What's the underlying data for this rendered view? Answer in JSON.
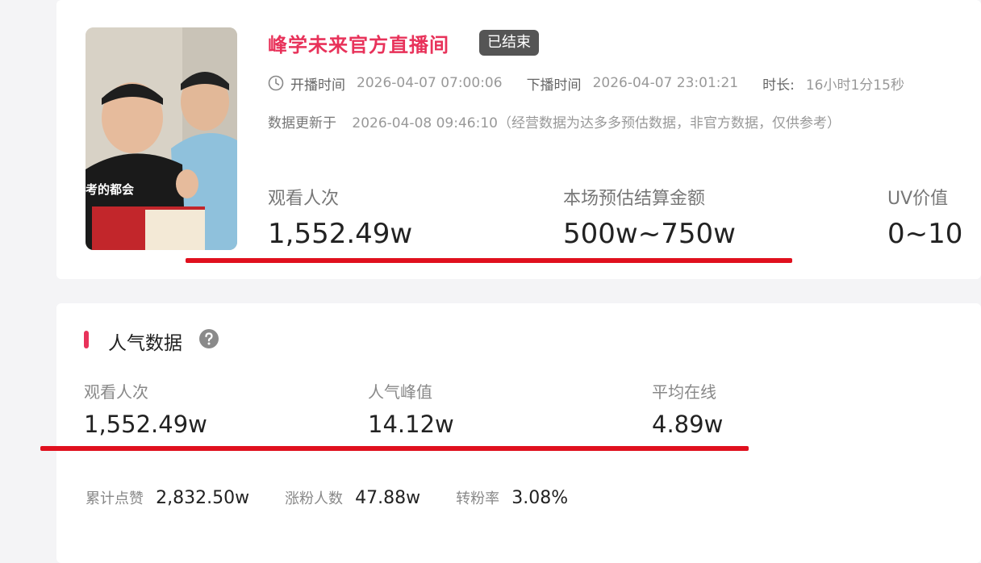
{
  "room": {
    "title": "峰学未来官方直播间",
    "status_badge": "已结束",
    "cover_badge_text": "考的都会",
    "start_label": "开播时间",
    "start_value": "2026-04-07 07:00:06",
    "end_label": "下播时间",
    "end_value": "2026-04-07 23:01:21",
    "duration_label": "时长:",
    "duration_value": "16小时1分15秒",
    "update_label": "数据更新于",
    "update_value": "2026-04-08 09:46:10（经营数据为达多多预估数据，非官方数据，仅供参考）",
    "metrics": {
      "views_label": "观看人次",
      "views_value": "1,552.49w",
      "settle_label": "本场预估结算金额",
      "settle_value": "500w~750w",
      "uv_label": "UV价值",
      "uv_value": "0~10"
    }
  },
  "popularity": {
    "title": "人气数据",
    "views_label": "观看人次",
    "views_value": "1,552.49w",
    "peak_label": "人气峰值",
    "peak_value": "14.12w",
    "avg_label": "平均在线",
    "avg_value": "4.89w",
    "likes_label": "累计点赞",
    "likes_value": "2,832.50w",
    "fans_label": "涨粉人数",
    "fans_value": "47.88w",
    "conv_label": "转粉率",
    "conv_value": "3.08%"
  },
  "icons": {
    "clock": "clock-icon",
    "help": "question-circle-icon"
  },
  "colors": {
    "accent": "#e8325a",
    "highlight_line": "#e0101e",
    "badge_bg": "#555555"
  }
}
